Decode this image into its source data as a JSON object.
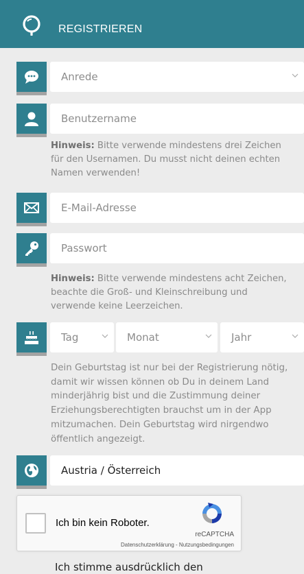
{
  "header": {
    "title": "REGISTRIEREN",
    "logo_icon": "location-pin-icon",
    "bg": "#2f7f8f"
  },
  "form": {
    "salutation": {
      "placeholder": "Anrede",
      "icon": "speech-bubble-icon"
    },
    "username": {
      "placeholder": "Benutzername",
      "icon": "user-icon",
      "hint_strong": "Hinweis:",
      "hint_lines": [
        "Bitte verwende mindestens drei Zeichen",
        "für den Usernamen. Du musst nicht deinen echten",
        "Namen verwenden!"
      ]
    },
    "email": {
      "placeholder": "E-Mail-Adresse",
      "icon": "envelope-icon"
    },
    "password": {
      "placeholder": "Passwort",
      "icon": "key-icon",
      "hint_strong": "Hinweis:",
      "hint_lines": [
        "Bitte verwende mindestens acht Zeichen,",
        "beachte die Groß- und Kleinschreibung und",
        "verwende keine Leerzeichen."
      ]
    },
    "birthday": {
      "icon": "birthday-cake-icon",
      "day": "Tag",
      "month": "Monat",
      "year": "Jahr",
      "hint_lines": [
        "Dein Geburtstag ist nur bei der Registrierung nötig,",
        "damit wir wissen können ob Du in deinem Land",
        "minderjährig bist und die Zustimmung deiner",
        "Erziehungsberechtigten brauchst um in der App",
        "mitzumachen. Dein Geburtstag wird nirgendwo",
        "öffentlich angezeigt."
      ]
    },
    "country": {
      "value": "Austria / Österreich",
      "icon": "globe-icon"
    }
  },
  "captcha": {
    "label": "Ich bin kein Roboter.",
    "brand": "reCAPTCHA",
    "links": "Datenschutzerklärung - Nutzungsbedingungen"
  },
  "consent": {
    "text": "Ich stimme ausdrücklich den"
  }
}
